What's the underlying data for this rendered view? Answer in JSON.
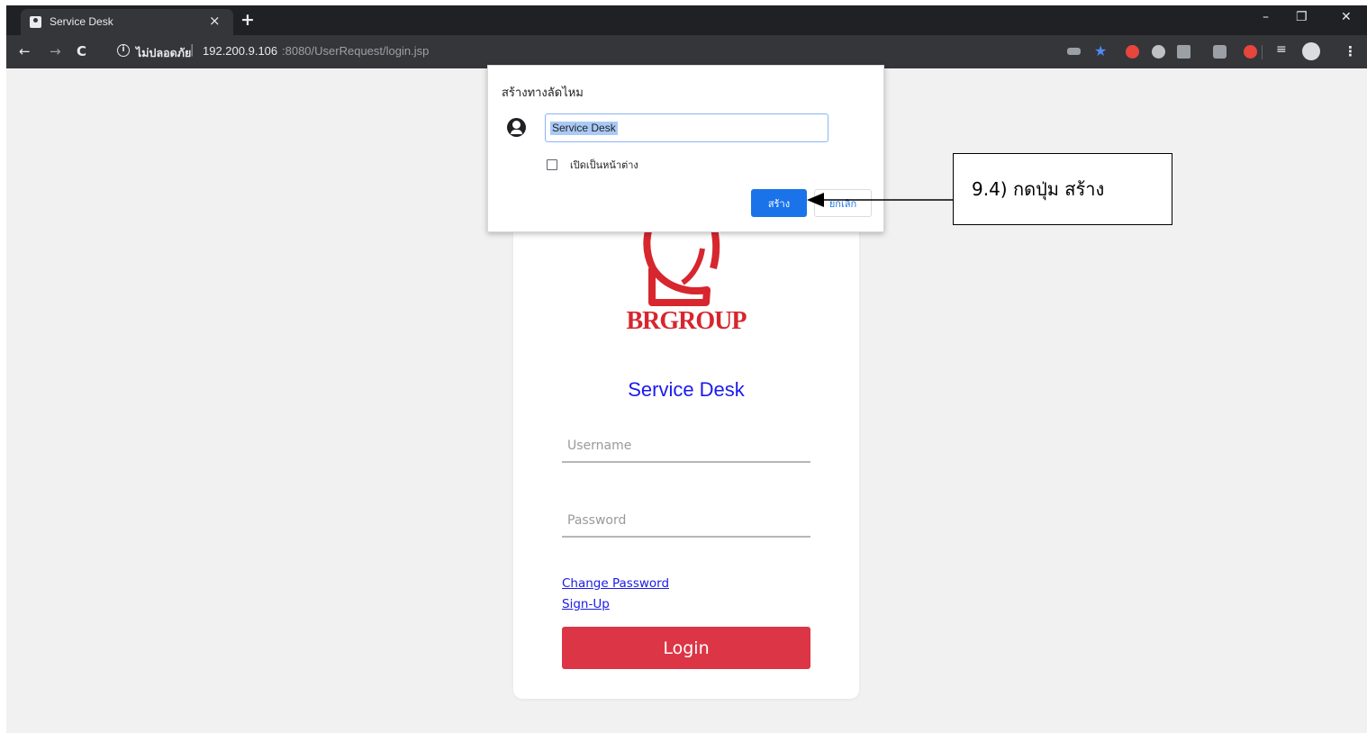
{
  "browser": {
    "tab": {
      "title": "Service Desk",
      "close_glyph": "×",
      "favicon": "person-icon"
    },
    "new_tab_glyph": "+",
    "window_controls": {
      "minimize": "–",
      "restore": "❐",
      "close": "✕"
    },
    "nav": {
      "back": "←",
      "forward": "→",
      "reload": "C"
    },
    "address": {
      "info_glyph": "i",
      "security_label": "ไม่ปลอดภัย",
      "separator": "|",
      "host": "192.200.9.106",
      "rest": ":8080/UserRequest/login.jsp"
    },
    "menu_glyph": "⋮",
    "icons": [
      "key-icon",
      "star-icon",
      "extension-icon",
      "profile-icon",
      "menu-icon"
    ]
  },
  "colors": {
    "chrome_dark": "#202124",
    "chrome_toolbar": "#35363a",
    "page_bg": "#f1f1f1",
    "brand_red": "#d7262e",
    "title_blue": "#1a1af0",
    "login_red": "#dc3545",
    "dialog_blue": "#1a73e8"
  },
  "login_card": {
    "logo_text": "BRGROUP",
    "title": "Service Desk",
    "username_placeholder": "Username",
    "password_placeholder": "Password",
    "change_password_link": "Change Password",
    "signup_link": "Sign-Up",
    "login_button": "Login"
  },
  "shortcut_dialog": {
    "title": "สร้างทางลัดไหม",
    "name_value": "Service Desk",
    "open_as_window_label": "เปิดเป็นหน้าต่าง",
    "create_button": "สร้าง",
    "cancel_button": "ยกเลิก"
  },
  "annotation": {
    "text": "9.4) กดปุ่ม สร้าง"
  }
}
